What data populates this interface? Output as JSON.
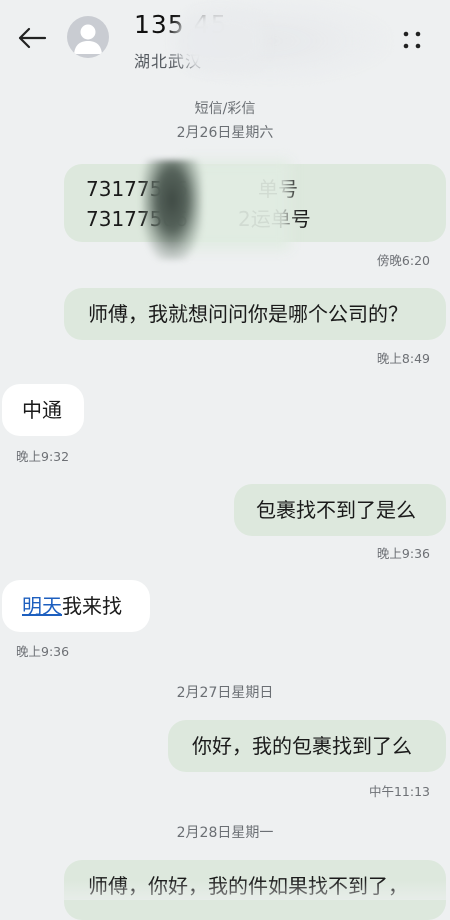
{
  "header": {
    "contact_number": "135 45",
    "contact_location": "湖北武汉",
    "back_icon": "arrow-left-icon",
    "menu_icon": "more-vertical-icon"
  },
  "messages": {
    "channel_label": "短信/彩信",
    "date_1": "2月26日星期六",
    "m1_line1": "73177506",
    "m1_line1_tail": "单号",
    "m1_line2": "73177506",
    "m1_line2_tail": "2运单号",
    "m1_time": "傍晚6:20",
    "m2_text": "师傅，我就想问问你是哪个公司的？",
    "m2_time": "晚上8:49",
    "m3_text": "中通",
    "m3_time": "晚上9:32",
    "m4_text": "包裹找不到了是么",
    "m4_time": "晚上9:36",
    "m5_link": "明天",
    "m5_text": "我来找",
    "m5_time": "晚上9:36",
    "date_2": "2月27日星期日",
    "m6_text": "你好，我的包裹找到了么",
    "m6_time": "中午11:13",
    "date_3": "2月28日星期一",
    "m7_text": "师傅，你好，我的件如果找不到了，"
  },
  "colors": {
    "background": "#eef0f1",
    "sent_bubble": "#dde8dd",
    "received_bubble": "#ffffff",
    "link": "#1d5fbf"
  }
}
